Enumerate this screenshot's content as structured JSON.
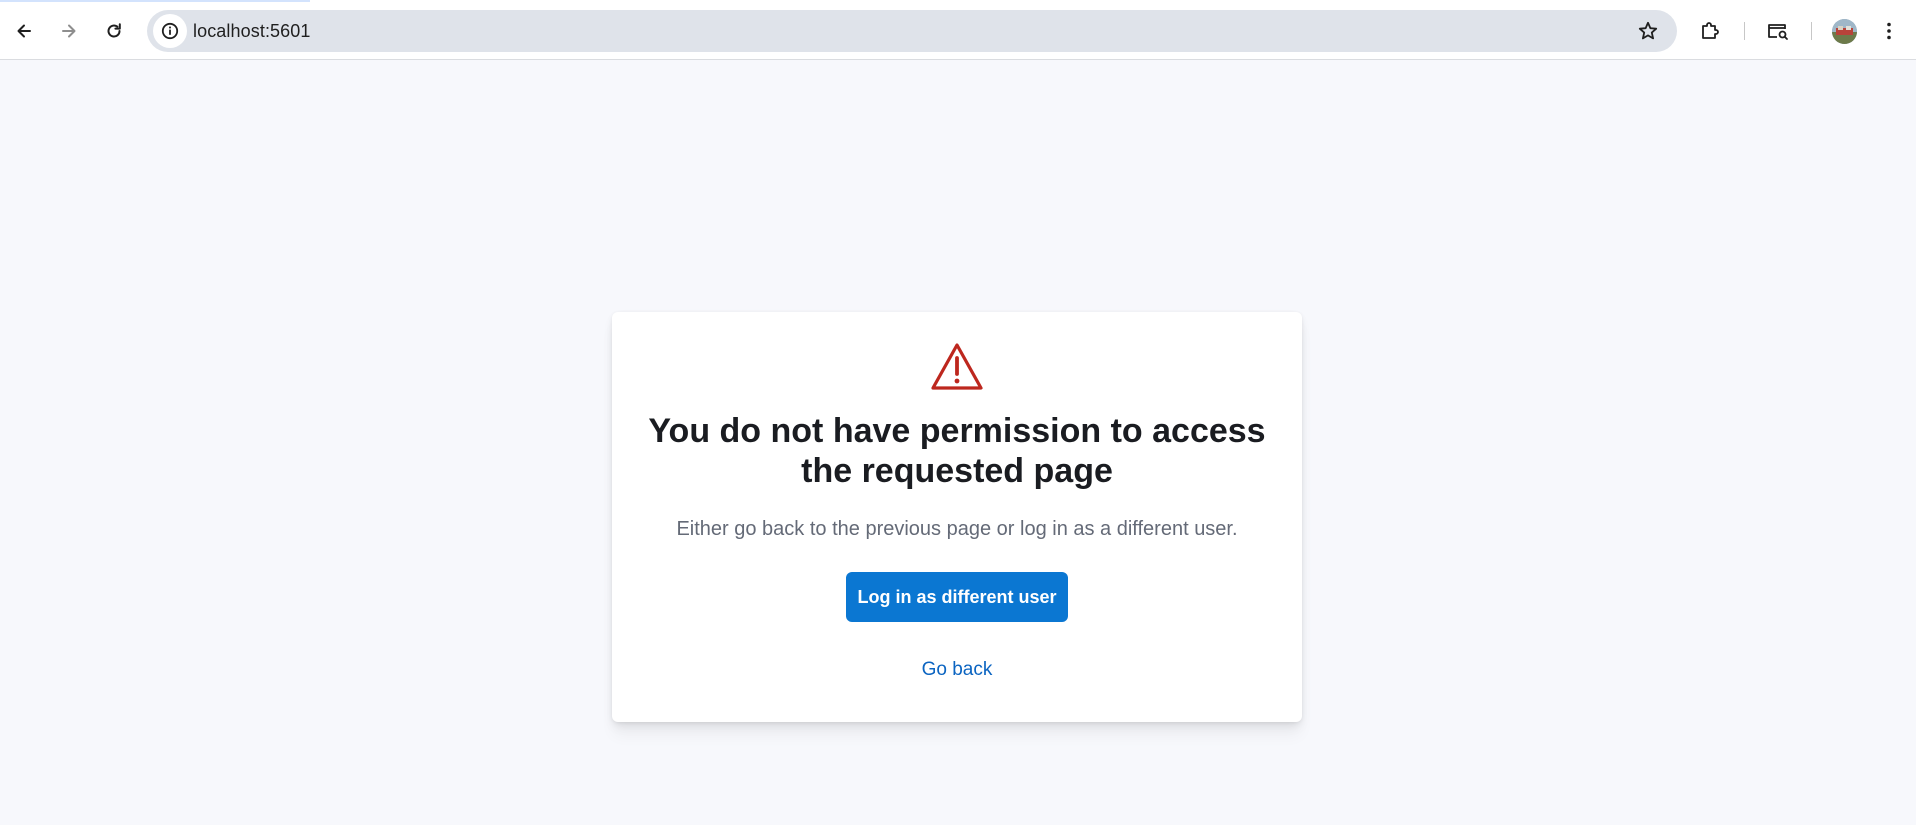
{
  "browser": {
    "url": "localhost:5601",
    "nav_icons": {
      "back": "back-arrow-icon",
      "forward": "forward-arrow-icon",
      "reload": "reload-icon",
      "site_info": "info-icon",
      "bookmark": "star-icon",
      "extensions": "puzzle-icon",
      "search_tab": "tab-search-icon",
      "profile": "avatar",
      "menu": "kebab-menu-icon"
    },
    "colors": {
      "toolbar_bg": "#ffffff",
      "omnibox_bg": "#dfe3ea"
    }
  },
  "page": {
    "background": "#f7f8fc",
    "card": {
      "icon": "warning-triangle-icon",
      "icon_color": "#bd271e",
      "title": "You do not have permission to access the requested page",
      "body": "Either go back to the previous page or log in as a different user.",
      "primary_button_label": "Log in as different user",
      "primary_button_color": "#0b77d2",
      "link_button_label": "Go back",
      "link_color": "#0b64c1"
    }
  }
}
